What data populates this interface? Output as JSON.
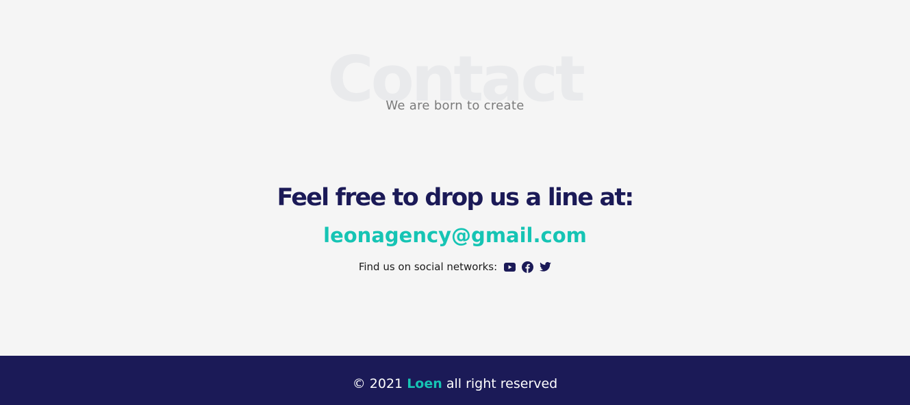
{
  "contact": {
    "background_title": "Contact",
    "subtitle": "We are born to create",
    "heading": "Feel free to drop us a line at:",
    "email": "leonagency@gmail.com",
    "social_label": "Find us on social networks:",
    "social_icons": [
      "youtube-icon",
      "facebook-icon",
      "twitter-icon"
    ]
  },
  "footer": {
    "copyright_prefix": "© 2021",
    "brand": "Loen",
    "copyright_suffix": "all right reserved"
  },
  "colors": {
    "page_background": "#f5f5f5",
    "background_title": "#e9eaec",
    "navy": "#1b1a57",
    "accent_teal": "#16c4b4",
    "subtitle_gray": "#7a7a7a",
    "footer_text": "#ffffff"
  }
}
